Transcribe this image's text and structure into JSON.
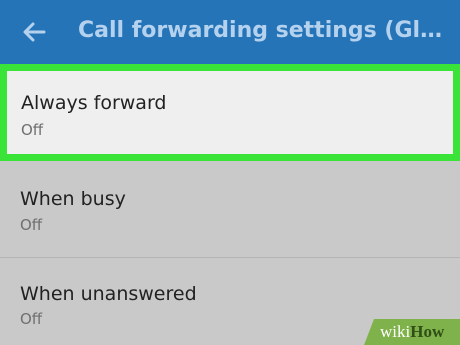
{
  "app_bar": {
    "title": "Call forwarding settings (Glo...",
    "back_icon": "arrow-left-icon",
    "color": "#2674b8"
  },
  "forwarding_options": [
    {
      "title": "Always forward",
      "status": "Off",
      "highlighted": true
    },
    {
      "title": "When busy",
      "status": "Off"
    },
    {
      "title": "When unanswered",
      "status": "Off"
    }
  ],
  "highlight_color": "#3ae338",
  "watermark": {
    "part1": "wiki",
    "part2": "How"
  }
}
